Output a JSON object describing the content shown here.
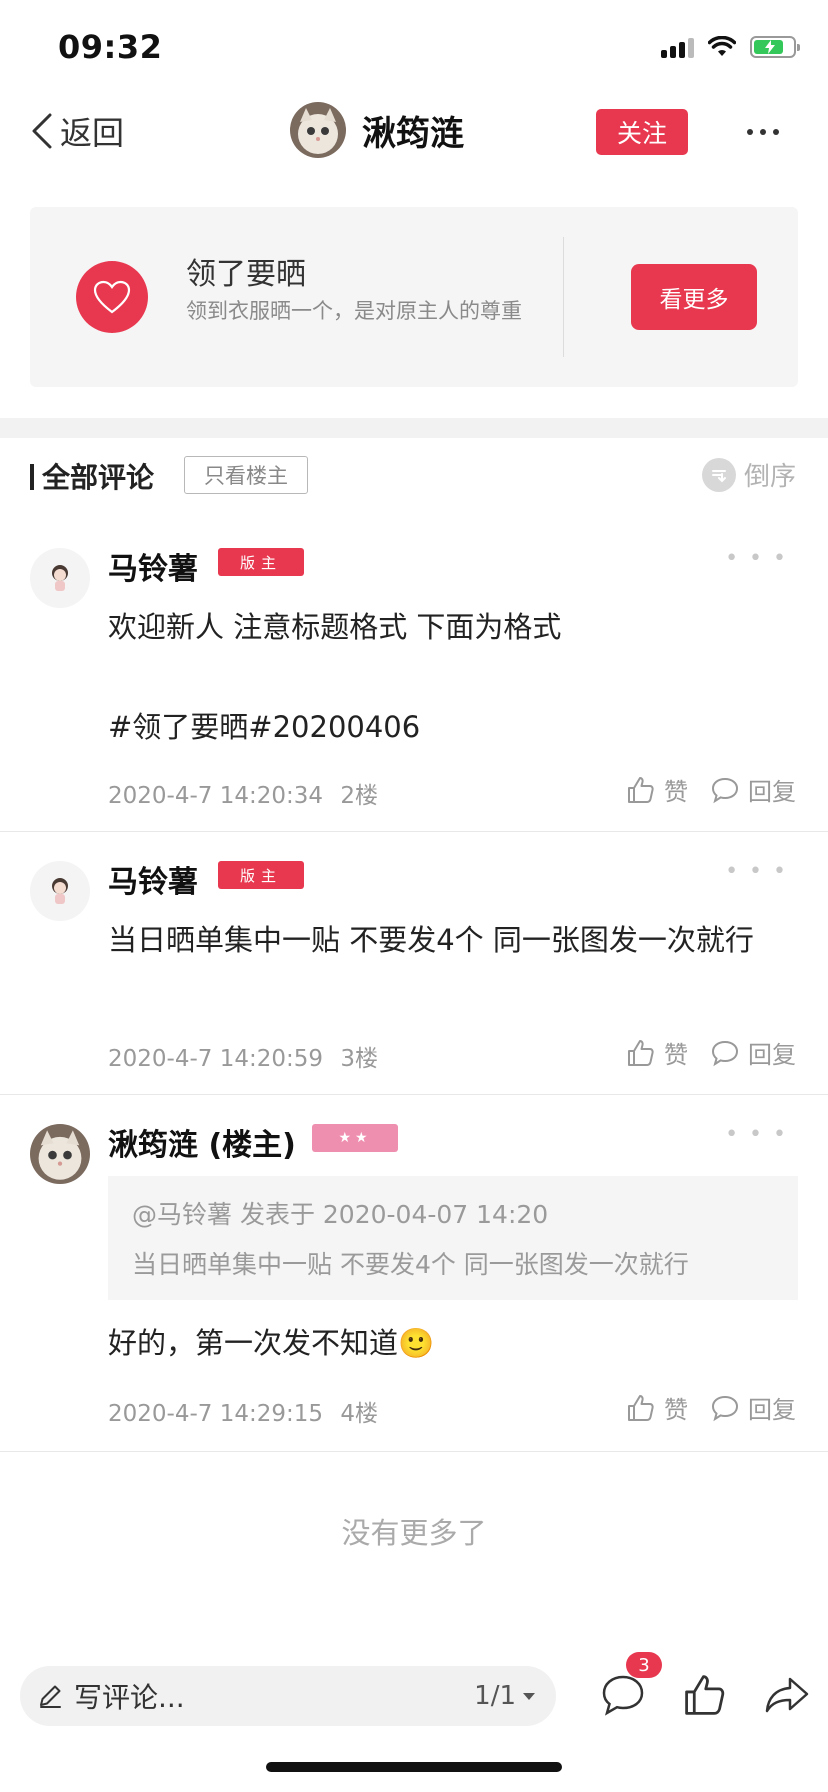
{
  "status_bar": {
    "time": "09:32",
    "battery_level": 0.75
  },
  "nav": {
    "back_label": "返回",
    "author_name": "湫筠涟",
    "follow_label": "关注",
    "more_icon": "more-dots-icon"
  },
  "forum": {
    "name": "领了要晒",
    "description": "领到衣服晒一个，是对原主人的尊重",
    "see_more_label": "看更多",
    "icon": "heart-icon"
  },
  "comments_header": {
    "title": "全部评论",
    "only_host_label": "只看楼主",
    "sort_label": "倒序"
  },
  "comments": [
    {
      "name": "马铃薯",
      "badge": "版主",
      "lines": [
        "欢迎新人 注意标题格式 下面为格式",
        "",
        "#领了要晒#20200406"
      ],
      "time": "2020-4-7 14:20:34",
      "floor": "2楼",
      "like_label": "赞",
      "reply_label": "回复"
    },
    {
      "name": "马铃薯",
      "badge": "版主",
      "text": "当日晒单集中一贴 不要发4个 同一张图发一次就行",
      "time": "2020-4-7 14:20:59",
      "floor": "3楼",
      "like_label": "赞",
      "reply_label": "回复"
    },
    {
      "name": "湫筠涟 (楼主)",
      "badge": "★★",
      "quote_header": "@马铃薯 发表于 2020-04-07 14:20",
      "quote_text": "当日晒单集中一贴 不要发4个 同一张图发一次就行",
      "text": "好的，第一次发不知道",
      "emoji": "🙂",
      "time": "2020-4-7 14:29:15",
      "floor": "4楼",
      "like_label": "赞",
      "reply_label": "回复"
    }
  ],
  "no_more_text": "没有更多了",
  "bottom_bar": {
    "input_placeholder": "写评论...",
    "page_indicator": "1/1",
    "comment_count": "3"
  },
  "colors": {
    "accent": "#e8384f",
    "stars_badge": "#ef8fb0",
    "muted_text": "#999999"
  }
}
